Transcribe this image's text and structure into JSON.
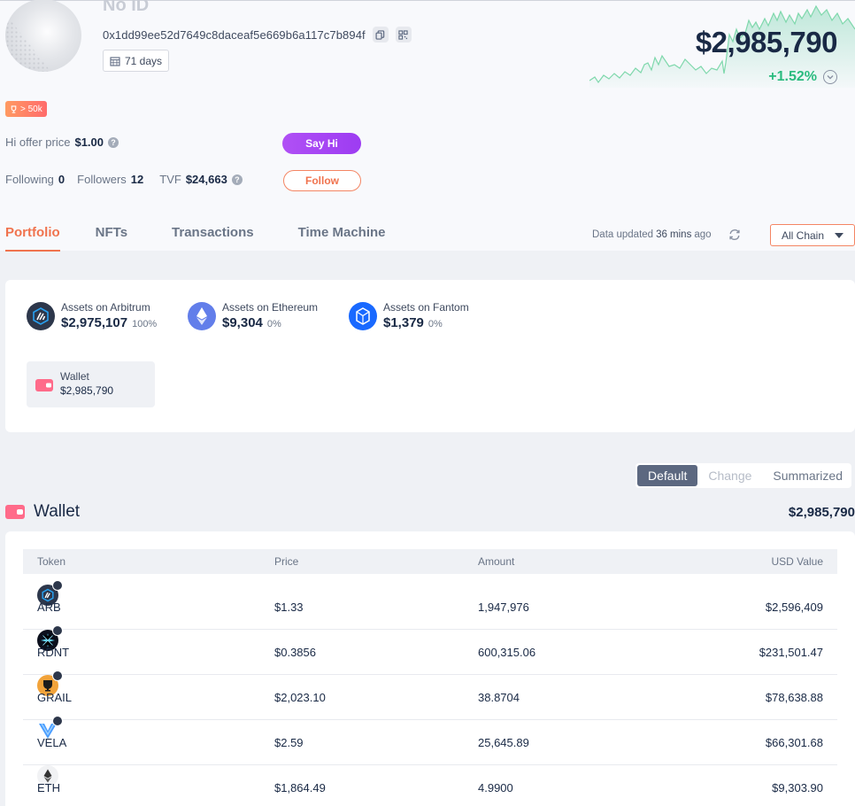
{
  "profile": {
    "name": "No ID",
    "address": "0x1dd99ee52d7649c8daceaf5e669b6a117c7b894f",
    "days": "71 days",
    "tier_badge": "> 50k",
    "net_worth": "$2,985,790",
    "change": "+1.52%",
    "hi_offer_label": "Hi offer price",
    "hi_offer_value": "$1.00",
    "say_hi_label": "Say Hi",
    "following_label": "Following",
    "following_value": "0",
    "followers_label": "Followers",
    "followers_value": "12",
    "tvf_label": "TVF",
    "tvf_value": "$24,663",
    "follow_label": "Follow"
  },
  "tabs": [
    {
      "label": "Portfolio",
      "active": true
    },
    {
      "label": "NFTs",
      "active": false
    },
    {
      "label": "Transactions",
      "active": false
    },
    {
      "label": "Time Machine",
      "active": false
    }
  ],
  "update": {
    "prefix": "Data updated",
    "value": "36 mins",
    "suffix": "ago"
  },
  "chain_filter": "All Chain",
  "chains": [
    {
      "label": "Assets on Arbitrum",
      "value": "$2,975,107",
      "pct": "100%",
      "icon": "arbitrum-icon",
      "color": "#2d374b"
    },
    {
      "label": "Assets on Ethereum",
      "value": "$9,304",
      "pct": "0%",
      "icon": "ethereum-icon",
      "color": "#627eea"
    },
    {
      "label": "Assets on Fantom",
      "value": "$1,379",
      "pct": "0%",
      "icon": "fantom-icon",
      "color": "#1969ff"
    }
  ],
  "wallet_tile": {
    "label": "Wallet",
    "value": "$2,985,790"
  },
  "view_toggle": {
    "default": "Default",
    "change": "Change",
    "summarized": "Summarized"
  },
  "wallet_section": {
    "title": "Wallet",
    "total": "$2,985,790"
  },
  "table": {
    "headers": {
      "token": "Token",
      "price": "Price",
      "amount": "Amount",
      "usd": "USD Value"
    },
    "rows": [
      {
        "token": "ARB",
        "price": "$1.33",
        "amount": "1,947,976",
        "usd": "$2,596,409",
        "icon": "arb-token-icon"
      },
      {
        "token": "RDNT",
        "price": "$0.3856",
        "amount": "600,315.06",
        "usd": "$231,501.47",
        "icon": "rdnt-token-icon"
      },
      {
        "token": "GRAIL",
        "price": "$2,023.10",
        "amount": "38.8704",
        "usd": "$78,638.88",
        "icon": "grail-token-icon"
      },
      {
        "token": "VELA",
        "price": "$2.59",
        "amount": "25,645.89",
        "usd": "$66,301.68",
        "icon": "vela-token-icon"
      },
      {
        "token": "ETH",
        "price": "$1,864.49",
        "amount": "4.9900",
        "usd": "$9,303.90",
        "icon": "eth-token-icon"
      }
    ]
  },
  "colors": {
    "accent": "#f0734e",
    "positive": "#2abb7f",
    "say_hi": "#a647f4"
  }
}
